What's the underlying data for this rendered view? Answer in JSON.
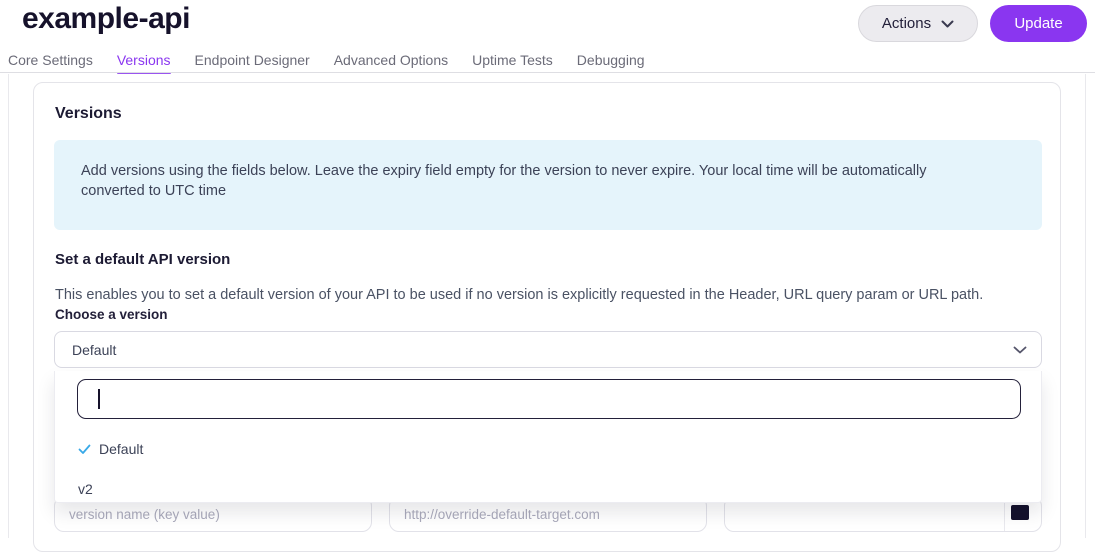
{
  "header": {
    "title": "example-api",
    "actions_label": "Actions",
    "update_label": "Update"
  },
  "tabs": [
    {
      "label": "Core Settings",
      "active": false
    },
    {
      "label": "Versions",
      "active": true
    },
    {
      "label": "Endpoint Designer",
      "active": false
    },
    {
      "label": "Advanced Options",
      "active": false
    },
    {
      "label": "Uptime Tests",
      "active": false
    },
    {
      "label": "Debugging",
      "active": false
    }
  ],
  "card": {
    "heading": "Versions",
    "info_text": "Add versions using the fields below. Leave the expiry field empty for the version to never expire. Your local time will be automatically converted to UTC time",
    "section_heading": "Set a default API version",
    "section_description": "This enables you to set a default version of your API to be used if no version is explicitly requested in the Header, URL query param or URL path.",
    "choose_label": "Choose a version",
    "select_value": "Default"
  },
  "dropdown": {
    "search_value": "",
    "options": [
      {
        "label": "Default",
        "selected": true
      },
      {
        "label": "v2",
        "selected": false
      }
    ]
  },
  "version_form": {
    "name_placeholder": "version name (key value)",
    "target_placeholder": "http://override-default-target.com",
    "expiry_value": ""
  },
  "icons": {
    "chevron_down": "v",
    "check": "✓",
    "calendar": "▪"
  },
  "colors": {
    "accent_purple": "#8A36F0",
    "info_box_bg": "#E5F4FB",
    "check_blue": "#38A9E8",
    "heading_dark": "#16122B"
  }
}
